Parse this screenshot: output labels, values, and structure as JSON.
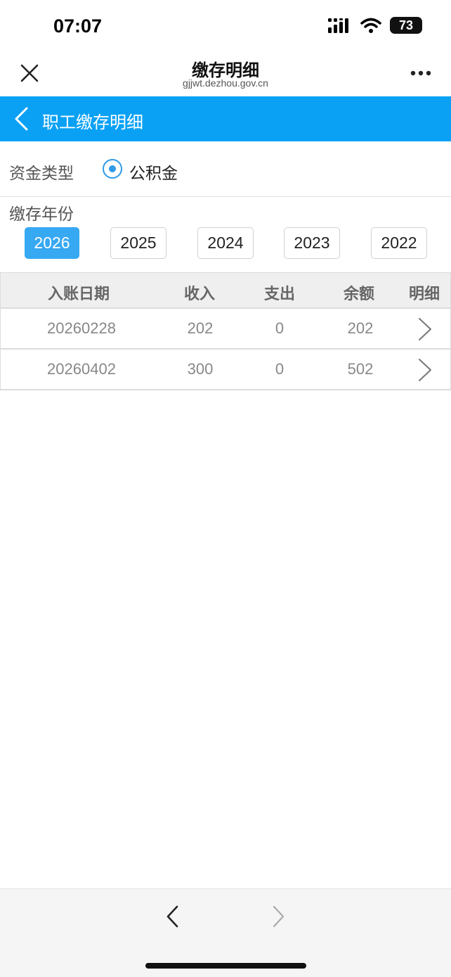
{
  "status_bar": {
    "time": "07:07",
    "battery": "73"
  },
  "nav": {
    "title": "缴存明细",
    "domain": "gjjwt.dezhou.gov.cn"
  },
  "header": {
    "title": "职工缴存明细"
  },
  "fund_type": {
    "label": "资金类型",
    "selected_option": "公积金"
  },
  "years": {
    "label": "缴存年份",
    "options": [
      "2026",
      "2025",
      "2024",
      "2023",
      "2022"
    ],
    "selected": "2026"
  },
  "table": {
    "columns": [
      "入账日期",
      "收入",
      "支出",
      "余额",
      "明细"
    ],
    "rows": [
      {
        "date": "20260228",
        "income": "202",
        "expense": "0",
        "balance": "202"
      },
      {
        "date": "20260402",
        "income": "300",
        "expense": "0",
        "balance": "502"
      }
    ]
  },
  "colors": {
    "accent": "#0aa1f5",
    "year_active": "#37a8f2",
    "radio": "#2e9be8"
  }
}
